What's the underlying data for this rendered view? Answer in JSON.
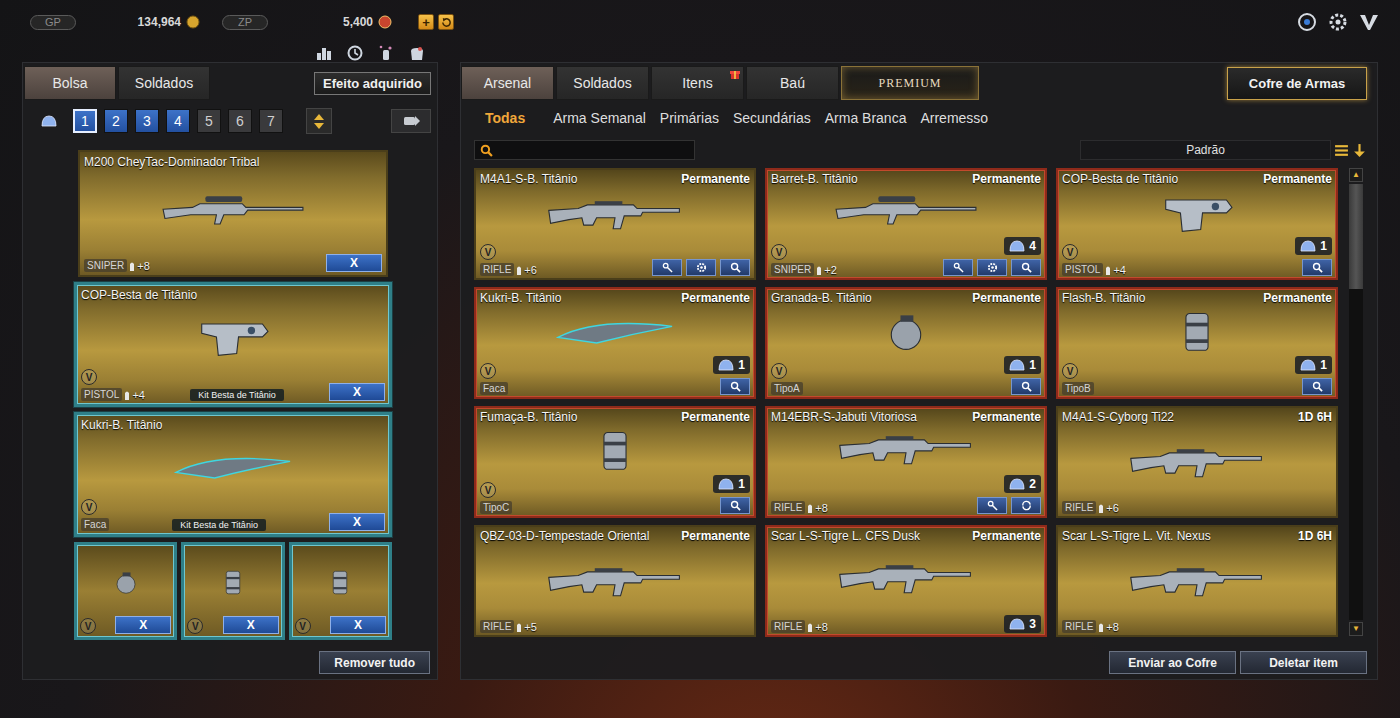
{
  "topbar": {
    "gp": {
      "label": "GP",
      "amount": "134,964"
    },
    "zp": {
      "label": "ZP",
      "amount": "5,400"
    },
    "add_button": "+"
  },
  "left_panel": {
    "tabs": [
      {
        "label": "Bolsa",
        "selected": true
      },
      {
        "label": "Soldados",
        "selected": false
      }
    ],
    "effect_button": "Efeito adquirido",
    "bags": [
      {
        "label": "1",
        "selected": true,
        "unlocked": true
      },
      {
        "label": "2",
        "selected": false,
        "unlocked": true
      },
      {
        "label": "3",
        "selected": false,
        "unlocked": true
      },
      {
        "label": "4",
        "selected": false,
        "unlocked": true
      },
      {
        "label": "5",
        "selected": false,
        "unlocked": false
      },
      {
        "label": "6",
        "selected": false,
        "unlocked": false
      },
      {
        "label": "7",
        "selected": false,
        "unlocked": false
      }
    ],
    "slots": [
      {
        "name": "M200 CheyTac-Dominador Tribal",
        "type": "SNIPER",
        "ammo": "+8",
        "kind": "sniper",
        "framed": false,
        "remove": "X"
      },
      {
        "name": "COP-Besta de Titânio",
        "type": "PISTOL",
        "ammo": "+4",
        "kind": "pistol",
        "framed": true,
        "badge": "V",
        "kit": "Kit Besta de Titânio",
        "remove": "X"
      },
      {
        "name": "Kukri-B. Titânio",
        "type": "Faca",
        "kind": "knife",
        "framed": true,
        "badge": "V",
        "kit": "Kit Besta de Titânio",
        "remove": "X"
      }
    ],
    "throwables": [
      {
        "kind": "grenade",
        "badge": "V",
        "remove": "X"
      },
      {
        "kind": "canister",
        "badge": "V",
        "remove": "X"
      },
      {
        "kind": "canister",
        "badge": "V",
        "remove": "X"
      }
    ],
    "remove_all": "Remover tudo"
  },
  "right_panel": {
    "tabs": [
      {
        "label": "Arsenal",
        "selected": true,
        "kind": "normal",
        "gift": false
      },
      {
        "label": "Soldados",
        "selected": false,
        "kind": "normal",
        "gift": false
      },
      {
        "label": "Itens",
        "selected": false,
        "kind": "normal",
        "gift": true
      },
      {
        "label": "Baú",
        "selected": false,
        "kind": "normal",
        "gift": false
      },
      {
        "label": "PREMIUM",
        "selected": false,
        "kind": "premium",
        "gift": false
      }
    ],
    "vault_button": "Cofre de Armas",
    "filters": [
      {
        "label": "Todas",
        "selected": true
      },
      {
        "label": "Arma Semanal",
        "selected": false
      },
      {
        "label": "Primárias",
        "selected": false
      },
      {
        "label": "Secundárias",
        "selected": false
      },
      {
        "label": "Arma Branca",
        "selected": false
      },
      {
        "label": "Arremesso",
        "selected": false
      }
    ],
    "sort": {
      "label": "Padrão"
    },
    "items": [
      {
        "name": "M4A1-S-B. Titânio",
        "duration": "Permanente",
        "type": "RIFLE",
        "ammo": "+6",
        "kind": "rifle",
        "badge": "V",
        "actions": [
          "upgrade",
          "settings",
          "inspect"
        ],
        "equipped": false
      },
      {
        "name": "Barret-B. Titânio",
        "duration": "Permanente",
        "type": "SNIPER",
        "ammo": "+2",
        "kind": "sniper",
        "badge": "V",
        "count": "4",
        "actions": [
          "upgrade",
          "settings",
          "inspect"
        ],
        "equipped": true
      },
      {
        "name": "COP-Besta de Titânio",
        "duration": "Permanente",
        "type": "PISTOL",
        "ammo": "+4",
        "kind": "pistol",
        "badge": "V",
        "count": "1",
        "actions": [
          "inspect"
        ],
        "equipped": true
      },
      {
        "name": "Kukri-B. Titânio",
        "duration": "Permanente",
        "type": "Faca",
        "kind": "knife",
        "badge": "V",
        "count": "1",
        "actions": [
          "inspect"
        ],
        "equipped": true
      },
      {
        "name": "Granada-B. Titânio",
        "duration": "Permanente",
        "type": "TipoA",
        "kind": "grenade",
        "badge": "V",
        "count": "1",
        "actions": [
          "inspect"
        ],
        "equipped": true
      },
      {
        "name": "Flash-B. Titânio",
        "duration": "Permanente",
        "type": "TipoB",
        "kind": "canister",
        "badge": "V",
        "count": "1",
        "actions": [
          "inspect"
        ],
        "equipped": true
      },
      {
        "name": "Fumaça-B. Titânio",
        "duration": "Permanente",
        "type": "TipoC",
        "kind": "canister",
        "badge": "V",
        "count": "1",
        "actions": [
          "inspect"
        ],
        "equipped": true
      },
      {
        "name": "M14EBR-S-Jabuti Vitoriosa",
        "duration": "Permanente",
        "type": "RIFLE",
        "ammo": "+8",
        "kind": "rifle",
        "count": "2",
        "actions": [
          "upgrade",
          "refresh"
        ],
        "equipped": true
      },
      {
        "name": "M4A1-S-Cyborg Ti22",
        "duration": "1D 6H",
        "type": "RIFLE",
        "ammo": "+6",
        "kind": "rifle",
        "actions": [],
        "equipped": false
      },
      {
        "name": "QBZ-03-D-Tempestade Oriental",
        "duration": "Permanente",
        "type": "RIFLE",
        "ammo": "+5",
        "kind": "rifle",
        "actions": [],
        "equipped": false
      },
      {
        "name": "Scar L-S-Tigre L. CFS Dusk",
        "duration": "Permanente",
        "type": "RIFLE",
        "ammo": "+8",
        "kind": "rifle",
        "count": "3",
        "actions": [],
        "equipped": true
      },
      {
        "name": "Scar L-S-Tigre L. Vit. Nexus",
        "duration": "1D 6H",
        "type": "RIFLE",
        "ammo": "+8",
        "kind": "rifle",
        "actions": [],
        "equipped": false
      }
    ],
    "scrollbar": {
      "up": "▲",
      "down": "▼",
      "level": 0.24
    },
    "footer_buttons": [
      "Enviar ao Cofre",
      "Deletar item"
    ]
  }
}
